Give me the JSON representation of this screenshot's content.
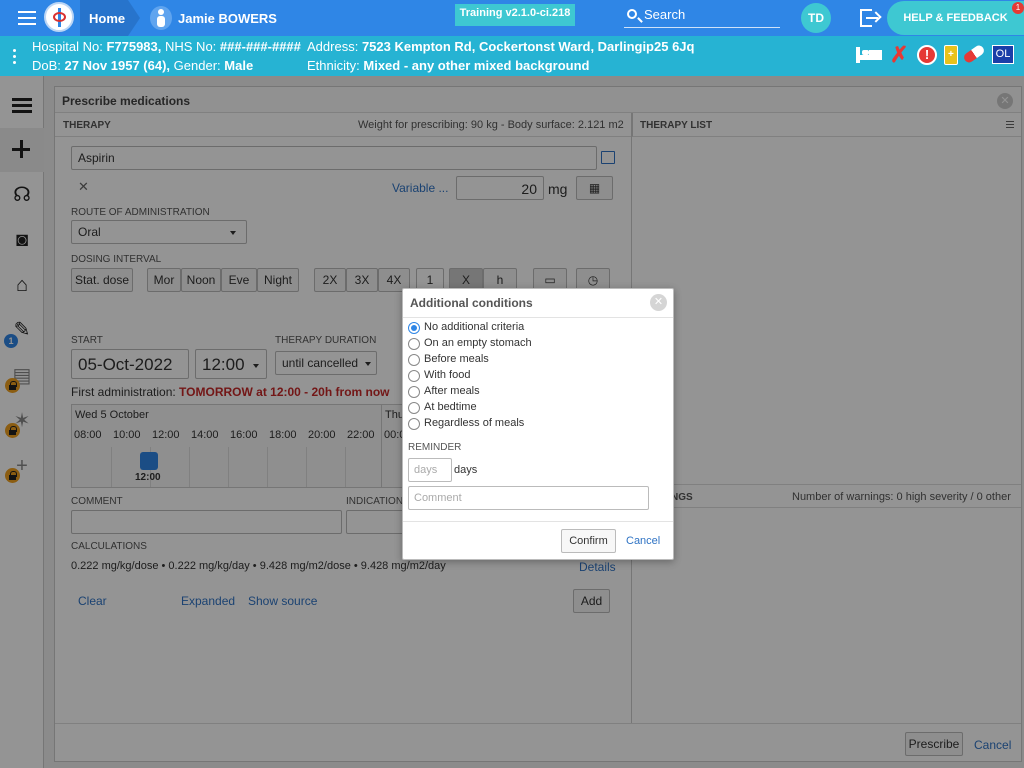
{
  "topbar": {
    "home_label": "Home",
    "patient_name": "Jamie BOWERS",
    "training": "Training v2.1.0-ci.218",
    "search_label": "Search",
    "user_initials": "TD",
    "help_label": "HELP & FEEDBACK",
    "help_badge": "1"
  },
  "patient": {
    "line1_label": "Hospital No:",
    "hospital_no": "F775983,",
    "nhs_label": "NHS No:",
    "nhs_no": "###-###-####",
    "address_label": "Address:",
    "address": "7523 Kempton Rd, Cockertonst Ward, Darlingip25 6Jq",
    "dob_label": "DoB:",
    "dob": "27 Nov 1957 (64),",
    "gender_label": "Gender:",
    "gender": "Male",
    "ethnicity_label": "Ethnicity:",
    "ethnicity": "Mixed - any other mixed background",
    "ol_badge": "OL"
  },
  "sidebar": {
    "badge_count": "1"
  },
  "main": {
    "title": "Prescribe medications",
    "therapy_label": "THERAPY",
    "weight_text": "Weight for prescribing: 90 kg - Body surface: 2.121 m2",
    "therapy_list_label": "THERAPY LIST",
    "medication": "Aspirin",
    "variable_link": "Variable ...",
    "dose_value": "20",
    "dose_unit": "mg",
    "route_label": "ROUTE OF ADMINISTRATION",
    "route_value": "Oral",
    "dosing_label": "DOSING INTERVAL",
    "stat_dose": "Stat. dose",
    "mor": "Mor",
    "noon": "Noon",
    "eve": "Eve",
    "night": "Night",
    "x2": "2X",
    "x3": "3X",
    "x4": "4X",
    "interval_count": "1",
    "x_btn": "X",
    "h_btn": "h",
    "start_label": "START",
    "start_date": "05-Oct-2022",
    "start_time": "12:00",
    "duration_label": "THERAPY DURATION",
    "duration_value": "until cancelled",
    "first_admin_label": "First administration:",
    "first_admin_value": "TOMORROW at 12:00 - 20h from now",
    "timeline_day": "Wed 5 October",
    "timeline_day2": "Thu",
    "timeline_hours": [
      "08:00",
      "10:00",
      "12:00",
      "14:00",
      "16:00",
      "18:00",
      "20:00",
      "22:00"
    ],
    "timeline_next": "00:0",
    "dose_time": "12:00",
    "comment_label": "COMMENT",
    "indication_label": "INDICATION",
    "calc_label": "CALCULATIONS",
    "calc_values": "0.222 mg/kg/dose • 0.222 mg/kg/day • 9.428 mg/m2/dose • 9.428 mg/m2/day",
    "details_link": "Details",
    "clear_link": "Clear",
    "expanded_link": "Expanded",
    "show_source_link": "Show source",
    "add_btn": "Add",
    "warnings_label": "NGS",
    "warnings_text": "Number of warnings: 0 high severity / 0 other",
    "prescribe_btn": "Prescribe",
    "cancel_link": "Cancel"
  },
  "modal": {
    "title": "Additional conditions",
    "options": [
      "No additional criteria",
      "On an empty stomach",
      "Before meals",
      "With food",
      "After meals",
      "At bedtime",
      "Regardless of meals"
    ],
    "selected_index": 0,
    "reminder_label": "REMINDER",
    "days_placeholder": "days",
    "days_unit": "days",
    "comment_placeholder": "Comment",
    "confirm_label": "Confirm",
    "cancel_label": "Cancel"
  }
}
